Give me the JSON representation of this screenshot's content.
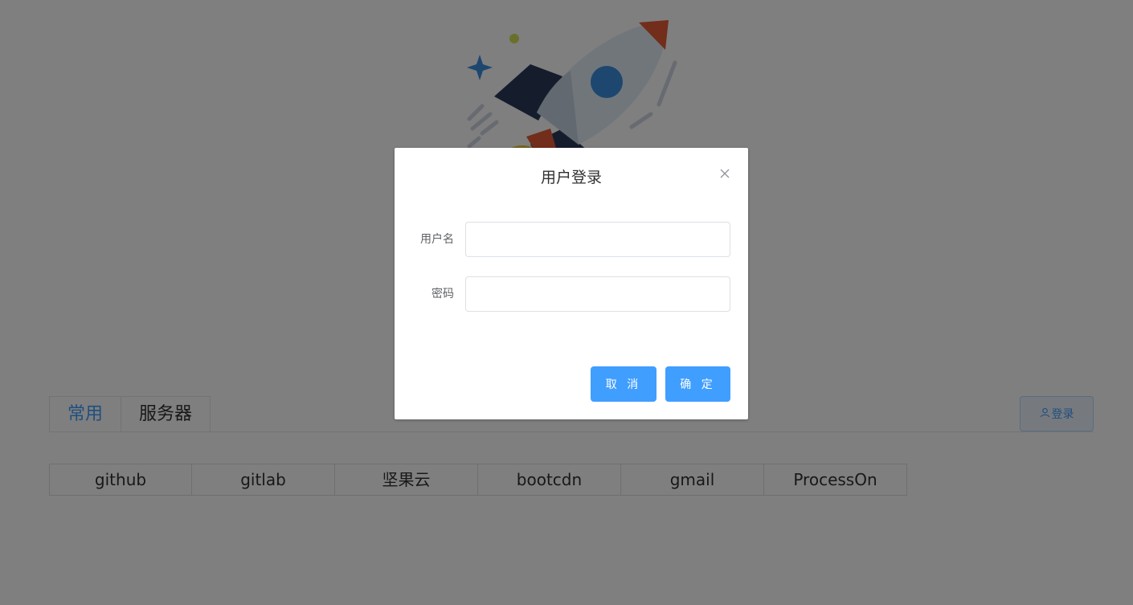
{
  "tabs": [
    "常用",
    "服务器"
  ],
  "header": {
    "login_label": "登录"
  },
  "links": [
    "github",
    "gitlab",
    "坚果云",
    "bootcdn",
    "gmail",
    "ProcessOn"
  ],
  "dialog": {
    "title": "用户登录",
    "username_label": "用户名",
    "username_value": "",
    "password_label": "密码",
    "password_value": "",
    "cancel_label": "取 消",
    "confirm_label": "确 定"
  },
  "colors": {
    "accent": "#409eff",
    "overlay": "rgba(0,0,0,0.5)"
  },
  "icons": [
    "rocket-illustration",
    "user-icon",
    "close-icon"
  ]
}
